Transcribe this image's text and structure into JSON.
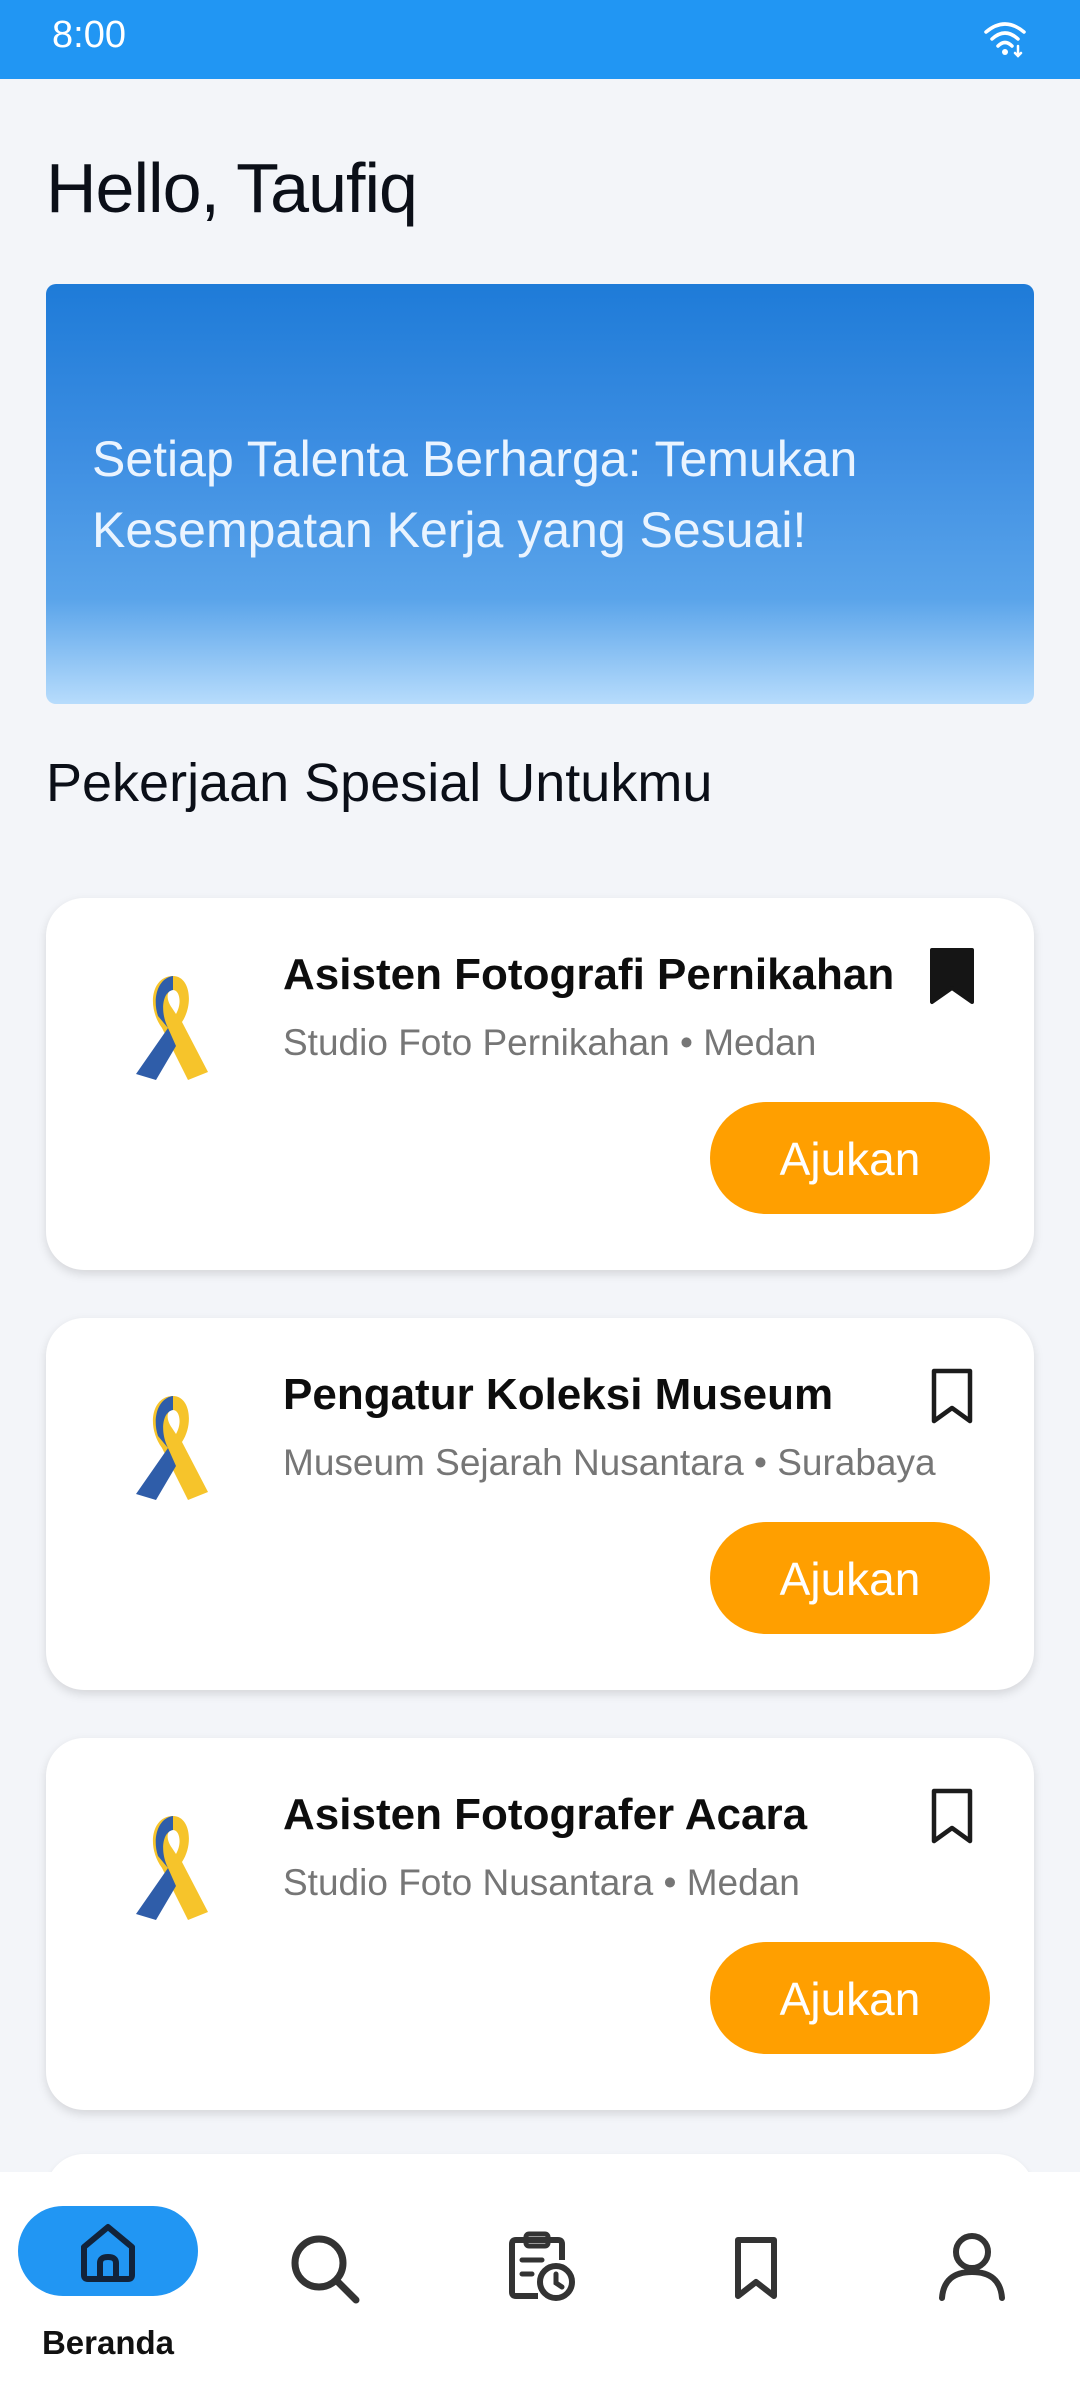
{
  "status_bar": {
    "time": "8:00",
    "icon": "wifi-icon"
  },
  "greeting": "Hello, Taufiq",
  "banner": {
    "text": "Setiap Talenta Berharga: Temukan Kesempatan Kerja yang Sesuai!"
  },
  "section_title": "Pekerjaan Spesial Untukmu",
  "jobs": [
    {
      "title": "Asisten Fotografi Pernikahan",
      "company": "Studio Foto Pernikahan • Medan",
      "bookmarked": true,
      "apply_label": "Ajukan",
      "logo": "awareness-ribbon-icon"
    },
    {
      "title": "Pengatur Koleksi Museum",
      "company": "Museum Sejarah Nusantara • Surabaya",
      "bookmarked": false,
      "apply_label": "Ajukan",
      "logo": "awareness-ribbon-icon"
    },
    {
      "title": "Asisten Fotografer Acara",
      "company": "Studio Foto Nusantara • Medan",
      "bookmarked": false,
      "apply_label": "Ajukan",
      "logo": "awareness-ribbon-icon"
    }
  ],
  "bottom_nav": {
    "items": [
      {
        "icon": "home-icon",
        "label": "Beranda",
        "active": true
      },
      {
        "icon": "search-icon",
        "label": "",
        "active": false
      },
      {
        "icon": "clipboard-clock-icon",
        "label": "",
        "active": false
      },
      {
        "icon": "bookmark-icon",
        "label": "",
        "active": false
      },
      {
        "icon": "profile-icon",
        "label": "",
        "active": false
      }
    ]
  },
  "colors": {
    "primary": "#2196f3",
    "accent": "#ff9f00",
    "ribbon_yellow": "#f6c42b",
    "ribbon_blue": "#2f5da9"
  }
}
